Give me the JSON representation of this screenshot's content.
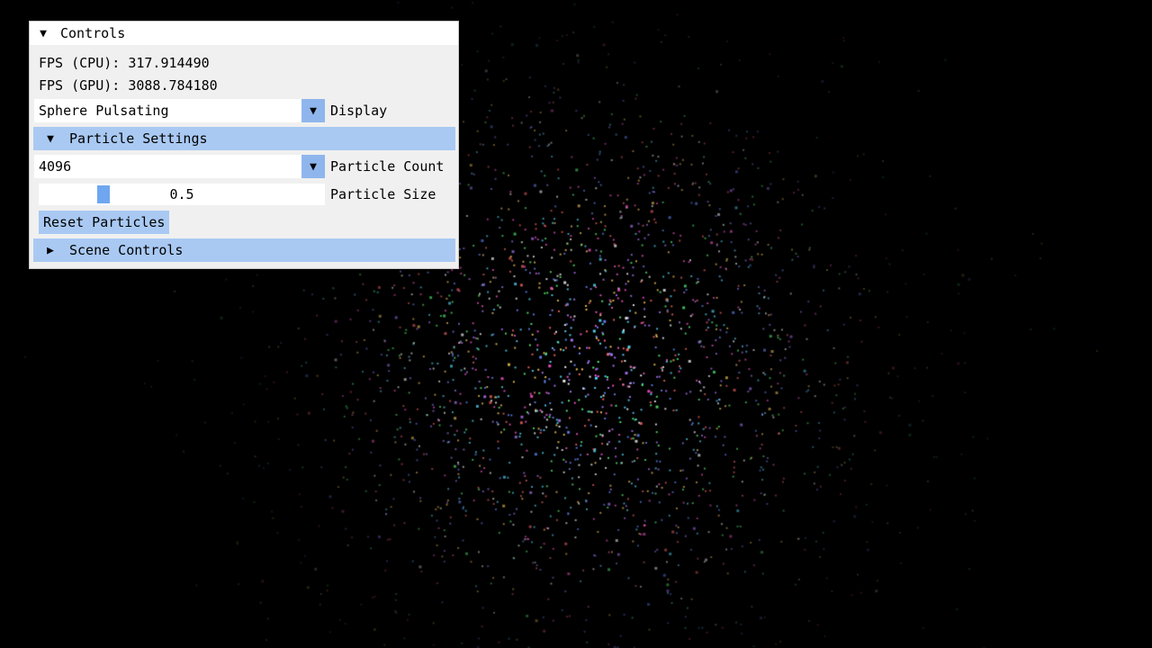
{
  "scene": {
    "mode": "Sphere Pulsating",
    "particle_count": 4096,
    "particle_size": 0.5,
    "colors": [
      "#ff5ad2",
      "#5adcff",
      "#5aff7a",
      "#ffd05a",
      "#b07aff",
      "#ff6a6a",
      "#ffffff",
      "#6a8cff"
    ]
  },
  "controls": {
    "title": "Controls",
    "fps_cpu": "FPS (CPU): 317.914490",
    "fps_gpu": "FPS (GPU): 3088.784180",
    "display_value": "Sphere Pulsating",
    "display_label": "Display",
    "particle_settings": {
      "header": "Particle Settings",
      "count_value": "4096",
      "count_label": "Particle Count",
      "size_value": "0.5",
      "size_label": "Particle Size",
      "reset_button": "Reset Particles"
    },
    "scene_controls": {
      "header": "Scene Controls"
    }
  },
  "icons": {
    "expanded": "triangle-down-icon",
    "collapsed": "triangle-right-icon",
    "combo_arrow": "chevron-down-icon"
  }
}
